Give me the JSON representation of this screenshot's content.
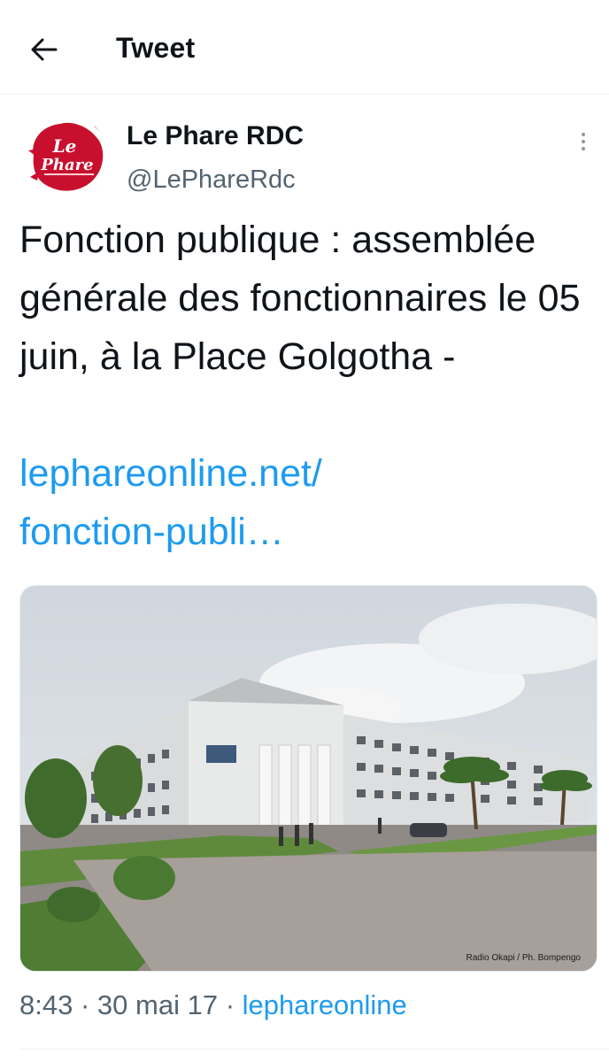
{
  "header": {
    "title": "Tweet",
    "back_icon": "arrow-left-icon"
  },
  "tweet": {
    "author": {
      "name": "Le Phare RDC",
      "handle": "@LePhareRdc",
      "avatar_text_1": "Le",
      "avatar_text_2": "Phare"
    },
    "text": "Fonction publique : assemblée générale des fonctionnaires le 05 juin, à la Place Golgotha -",
    "link_line_1": "lephareonline.net/",
    "link_line_2": "fonction-publi…",
    "media": {
      "credit": "Radio Okapi / Ph. Bompengo"
    },
    "time": "8:43",
    "date": "30 mai 17",
    "separator": "·",
    "source": "lephareonline"
  },
  "colors": {
    "link": "#1d9bf0",
    "muted": "#536471",
    "text": "#0f1419",
    "brand_red": "#c8102e"
  }
}
